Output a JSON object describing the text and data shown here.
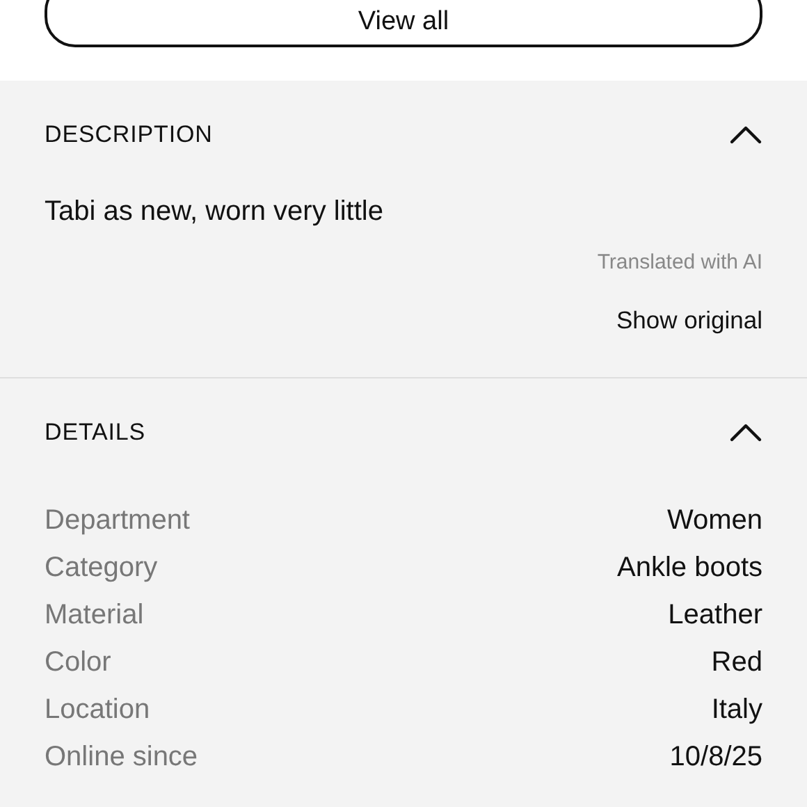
{
  "view_all_button": {
    "label": "View all"
  },
  "sections": [
    {
      "title": "DESCRIPTION",
      "expanded": true,
      "kind": "text",
      "body": "Tabi as new, worn very little",
      "note": "Translated with AI",
      "link": "Show original"
    },
    {
      "title": "DETAILS",
      "expanded": true,
      "kind": "details",
      "rows": [
        {
          "label": "Department",
          "value": "Women"
        },
        {
          "label": "Category",
          "value": "Ankle boots"
        },
        {
          "label": "Material",
          "value": "Leather"
        },
        {
          "label": "Color",
          "value": "Red"
        },
        {
          "label": "Location",
          "value": "Italy"
        },
        {
          "label": "Online since",
          "value": "10/8/25"
        }
      ]
    }
  ]
}
